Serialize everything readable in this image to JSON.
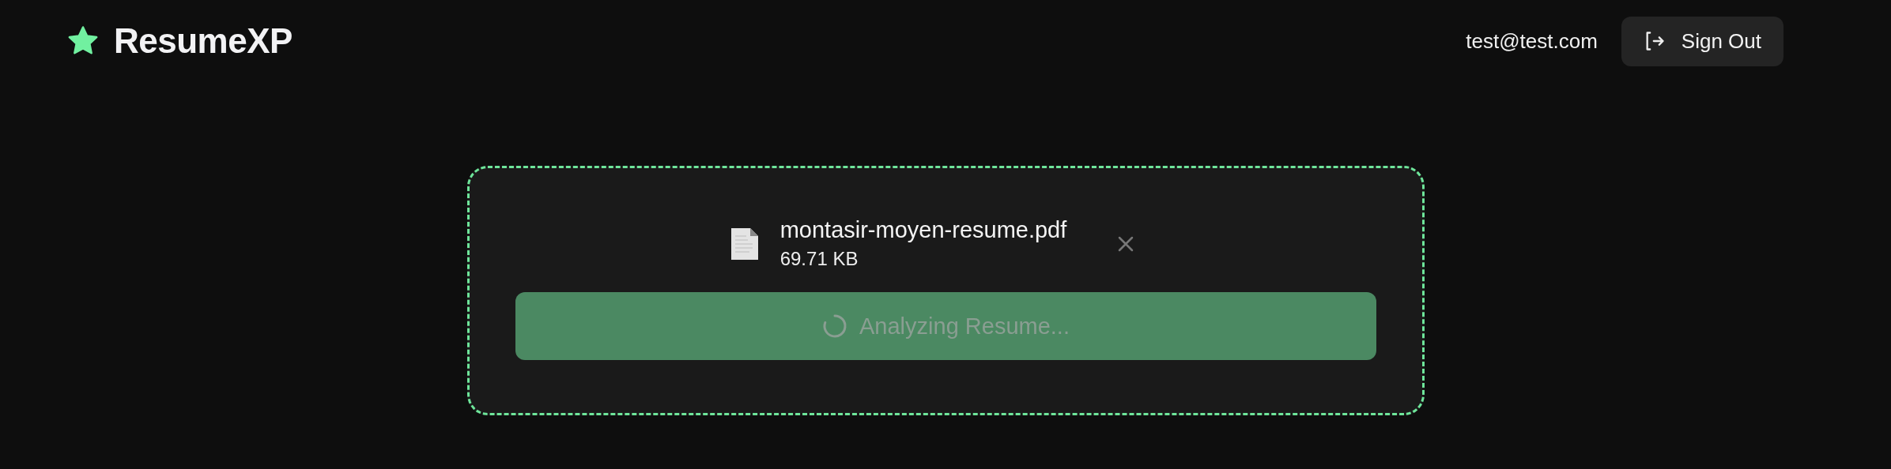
{
  "header": {
    "brand": "ResumeXP",
    "user_email": "test@test.com",
    "sign_out_label": "Sign Out"
  },
  "upload": {
    "file_name": "montasir-moyen-resume.pdf",
    "file_size": "69.71 KB",
    "analyze_button": {
      "label": "Analyzing Resume...",
      "disabled": true
    }
  }
}
